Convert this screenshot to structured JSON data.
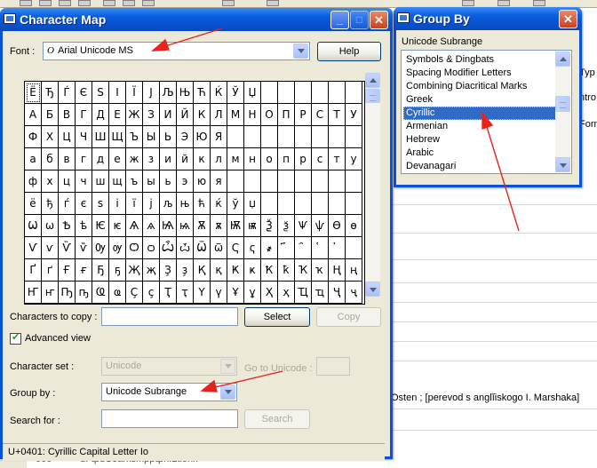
{
  "character_map": {
    "title": "Character Map",
    "font_label": "Font :",
    "font_value": "Arial Unicode MS",
    "font_icon": "O",
    "help_button": "Help",
    "characters": [
      [
        "Ё",
        "Ђ",
        "Ѓ",
        "Є",
        "S",
        "І",
        "Ї",
        "J",
        "Љ",
        "Њ",
        "Ћ",
        "Ќ",
        "Ў",
        "Џ"
      ],
      [
        "А",
        "Б",
        "В",
        "Г",
        "Д",
        "Е",
        "Ж",
        "З",
        "И",
        "Й",
        "К",
        "Л",
        "М",
        "Н",
        "О",
        "П",
        "Р",
        "С",
        "Т",
        "У"
      ],
      [
        "Ф",
        "Х",
        "Ц",
        "Ч",
        "Ш",
        "Щ",
        "Ъ",
        "Ы",
        "Ь",
        "Э",
        "Ю",
        "Я"
      ],
      [
        "а",
        "б",
        "в",
        "г",
        "д",
        "е",
        "ж",
        "з",
        "и",
        "й",
        "к",
        "л",
        "м",
        "н",
        "о",
        "п",
        "р",
        "с",
        "т",
        "у"
      ],
      [
        "ф",
        "х",
        "ц",
        "ч",
        "ш",
        "щ",
        "ъ",
        "ы",
        "ь",
        "э",
        "ю",
        "я"
      ],
      [
        "ё",
        "ђ",
        "ѓ",
        "є",
        "ѕ",
        "і",
        "ї",
        "ј",
        "љ",
        "њ",
        "ћ",
        "ќ",
        "ў",
        "џ"
      ],
      [
        "Ѡ",
        "ѡ",
        "Ѣ",
        "ѣ",
        "Ѥ",
        "ѥ",
        "Ѧ",
        "ѧ",
        "Ѩ",
        "ѩ",
        "Ѫ",
        "ѫ",
        "Ѭ",
        "ѭ",
        "Ѯ",
        "ѯ",
        "Ѱ",
        "ѱ",
        "Ѳ",
        "ѳ"
      ],
      [
        "Ѵ",
        "ѵ",
        "Ѷ",
        "ѷ",
        "Ѹ",
        "ѹ",
        "Ѻ",
        "ѻ",
        "Ѽ",
        "ѽ",
        "Ѿ",
        "ѿ",
        "Ҁ",
        "ҁ",
        "҂",
        "҃",
        "҄",
        "҅",
        "҆",
        ""
      ],
      [
        "Ґ",
        "ґ",
        "Ғ",
        "ғ",
        "Ҕ",
        "ҕ",
        "Җ",
        "җ",
        "Ҙ",
        "ҙ",
        "Қ",
        "қ",
        "Ҝ",
        "ҝ",
        "Ҟ",
        "ҟ",
        "Ҡ",
        "ҡ",
        "Ң",
        "ң"
      ],
      [
        "Ҥ",
        "ҥ",
        "Ҧ",
        "ҧ",
        "Ҩ",
        "ҩ",
        "Ҫ",
        "ҫ",
        "Ҭ",
        "ҭ",
        "Ү",
        "ү",
        "Ұ",
        "ұ",
        "Ҳ",
        "ҳ",
        "Ҵ",
        "ҵ",
        "Ҷ",
        "ҷ"
      ]
    ],
    "characters_to_copy_label": "Characters to copy :",
    "characters_to_copy_value": "",
    "select_button": "Select",
    "copy_button": "Copy",
    "advanced_view_label": "Advanced view",
    "advanced_view_checked": true,
    "character_set_label": "Character set :",
    "character_set_value": "Unicode",
    "go_to_unicode_label": "Go to Unicode :",
    "go_to_unicode_value": "",
    "group_by_label": "Group by :",
    "group_by_value": "Unicode Subrange",
    "search_for_label": "Search for :",
    "search_for_value": "",
    "search_button": "Search",
    "status": "U+0401: Cyrillic Capital Letter Io"
  },
  "group_by": {
    "title": "Group By",
    "heading": "Unicode Subrange",
    "items": [
      "Symbols & Dingbats",
      "Spacing Modifier Letters",
      "Combining Diacritical Marks",
      "Greek",
      "Cyrillic",
      "Armenian",
      "Hebrew",
      "Arabic",
      "Devanagari"
    ],
    "selected_index": 4
  },
  "background": {
    "fragment_typ": "Typ",
    "fragment_ntro": "ntro",
    "fragment_form": "Form",
    "citation_text": "Osten ; [perevod s anglĭiskogo I. Marshaka]",
    "bottom_text": "d. ȹdƟJarksmppȹn.Ƚtlonr.",
    "bottom_code": "000"
  },
  "colors": {
    "titlebar": "#0a5fe0",
    "selection": "#316ac5",
    "window_face": "#ece9d8",
    "annotation_arrow": "#e8231e"
  }
}
